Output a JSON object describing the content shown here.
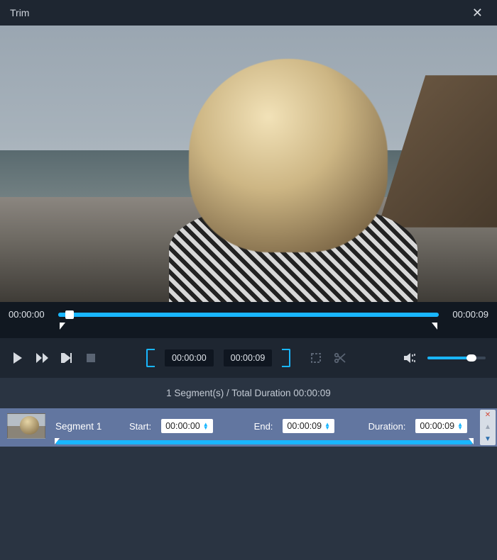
{
  "window": {
    "title": "Trim"
  },
  "timeline": {
    "current_time": "00:00:00",
    "total_time": "00:00:09"
  },
  "trim_controls": {
    "in_time": "00:00:00",
    "out_time": "00:00:09"
  },
  "summary": {
    "text": "1 Segment(s) / Total Duration 00:00:09"
  },
  "segment": {
    "name": "Segment 1",
    "start_label": "Start:",
    "start_value": "00:00:00",
    "end_label": "End:",
    "end_value": "00:00:09",
    "duration_label": "Duration:",
    "duration_value": "00:00:09"
  },
  "colors": {
    "accent": "#19b6ff"
  }
}
